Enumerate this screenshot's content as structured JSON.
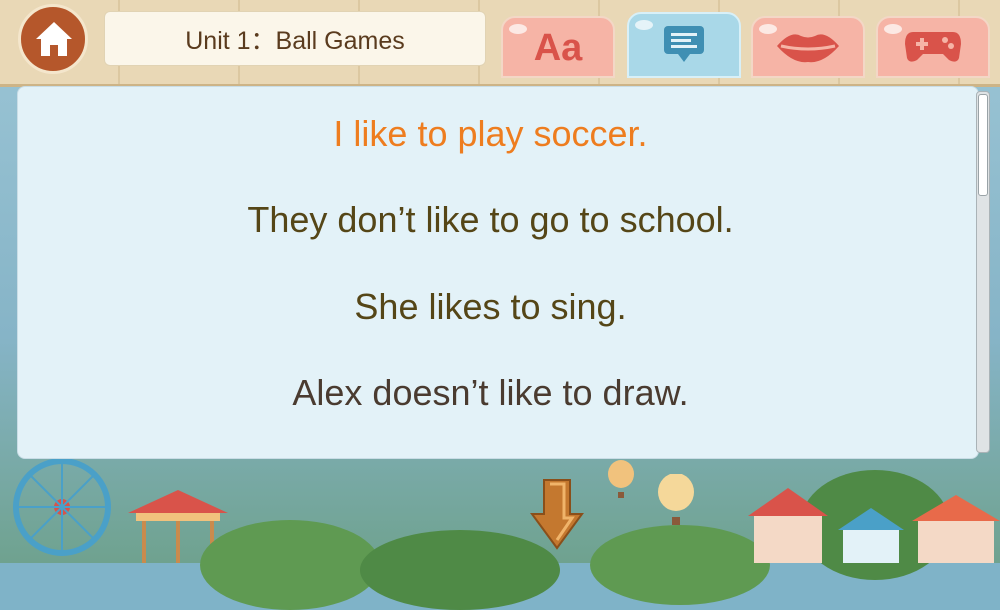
{
  "header": {
    "title": "Unit 1：Ball Games",
    "tabs": [
      {
        "name": "vocabulary",
        "label": "Aa",
        "selected": false
      },
      {
        "name": "sentences",
        "icon": "chat-bubble-icon",
        "selected": true
      },
      {
        "name": "speaking",
        "icon": "lips-icon",
        "selected": false
      },
      {
        "name": "game",
        "icon": "gamepad-icon",
        "selected": false
      }
    ]
  },
  "sentences": [
    {
      "text": "I like to play soccer.",
      "color": "#ee7d1f",
      "active": true
    },
    {
      "text": "They don’t like to go to school.",
      "color": "#554617",
      "active": false
    },
    {
      "text": "She likes to sing.",
      "color": "#554617",
      "active": false
    },
    {
      "text": "Alex doesn’t like to draw.",
      "color": "#4a3b30",
      "active": false
    }
  ],
  "colors": {
    "active_sentence": "#ee7d1f",
    "tab_selected": "#a9d8e8",
    "tab_default": "#f6b4a6",
    "home": "#b5572b"
  },
  "icons": {
    "home": "home-icon",
    "next": "down-arrow-icon"
  }
}
